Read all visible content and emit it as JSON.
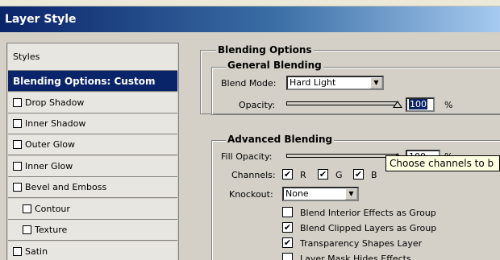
{
  "window": {
    "title": "Layer Style"
  },
  "styles_list": {
    "header": "Styles",
    "items": [
      {
        "label": "Blending Options: Custom",
        "selected": true,
        "checkbox": false,
        "indent": false
      },
      {
        "label": "Drop Shadow",
        "checked": false,
        "indent": false
      },
      {
        "label": "Inner Shadow",
        "checked": false,
        "indent": false
      },
      {
        "label": "Outer Glow",
        "checked": false,
        "indent": false
      },
      {
        "label": "Inner Glow",
        "checked": false,
        "indent": false
      },
      {
        "label": "Bevel and Emboss",
        "checked": false,
        "indent": false
      },
      {
        "label": "Contour",
        "checked": false,
        "indent": true
      },
      {
        "label": "Texture",
        "checked": false,
        "indent": true
      },
      {
        "label": "Satin",
        "checked": false,
        "indent": false
      }
    ]
  },
  "blending_options": {
    "title": "Blending Options",
    "general": {
      "title": "General Blending",
      "blend_mode_label": "Blend Mode:",
      "blend_mode_value": "Hard Light",
      "opacity_label": "Opacity:",
      "opacity_value": "100",
      "opacity_unit": "%"
    },
    "advanced": {
      "title": "Advanced Blending",
      "fill_opacity_label": "Fill Opacity:",
      "fill_opacity_value": "100",
      "fill_opacity_unit": "%",
      "channels_label": "Channels:",
      "channels": [
        {
          "label": "R",
          "checked": true
        },
        {
          "label": "G",
          "checked": true
        },
        {
          "label": "B",
          "checked": true
        }
      ],
      "knockout_label": "Knockout:",
      "knockout_value": "None",
      "options": [
        {
          "label": "Blend Interior Effects as Group",
          "checked": false
        },
        {
          "label": "Blend Clipped Layers as Group",
          "checked": true
        },
        {
          "label": "Transparency Shapes Layer",
          "checked": true
        },
        {
          "label": "Layer Mask Hides Effects",
          "checked": false
        }
      ]
    }
  },
  "tooltip": {
    "text": "Choose channels to b"
  },
  "check_mark": "✔",
  "dropdown_arrow": "▼",
  "colors": {
    "selection": "#0a246a",
    "title_gradient_start": "#0a246a",
    "tooltip_bg": "#ffffe1"
  }
}
